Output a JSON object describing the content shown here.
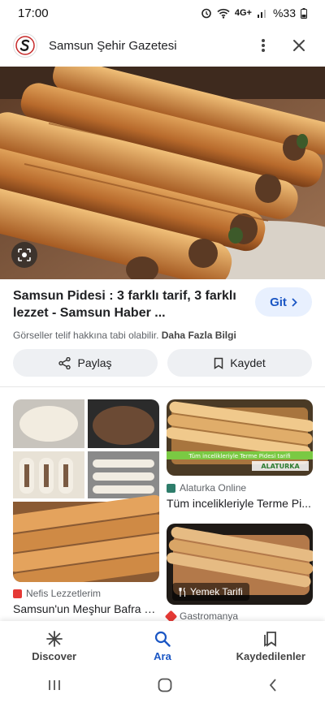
{
  "status_bar": {
    "time": "17:00",
    "network": "4G+",
    "battery": "%33"
  },
  "header": {
    "site_name": "Samsun Şehir Gazetesi"
  },
  "result": {
    "title": "Samsun Pidesi : 3 farklı tarif, 3 farklı lezzet - Samsun Haber ...",
    "copyright_text": "Görseller telif hakkına tabi olabilir.",
    "more_info_link": "Daha Fazla Bilgi",
    "visit_button": "Git"
  },
  "actions": {
    "share": "Paylaş",
    "save": "Kaydet"
  },
  "related": [
    {
      "source": "Nefis Lezzetlerim",
      "title": "Samsun'un Meşhur Bafra P...",
      "source_color": "#e53935"
    },
    {
      "source": "Alaturka Online",
      "title": "Tüm incelikleriyle Terme Pi...",
      "source_color": "#2e7d6b",
      "caption": "Tüm incelikleriyle Terme Pidesi tarifi",
      "watermark": "ALATURKA"
    },
    {
      "source": "Gastromanya",
      "source_color": "#e53935",
      "tag": "Yemek Tarifi"
    }
  ],
  "bottom_nav": {
    "discover": "Discover",
    "search": "Ara",
    "saved": "Kaydedilenler"
  },
  "colors": {
    "accent": "#1a56c4",
    "visit_bg": "#e8f0fe",
    "chip_bg": "#eef0f3"
  }
}
